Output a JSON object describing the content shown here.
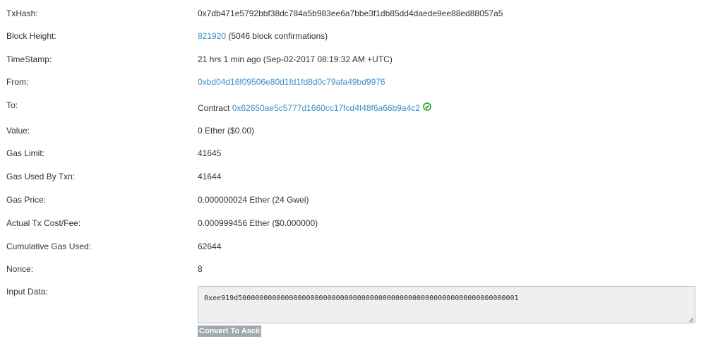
{
  "rows": {
    "txhash": {
      "label": "TxHash:",
      "value": "0x7db471e5792bbf38dc784a5b983ee6a7bbe3f1db85dd4daede9ee88ed88057a5"
    },
    "block_height": {
      "label": "Block Height:",
      "block": "821920",
      "confirmations": "(5046 block confirmations)"
    },
    "timestamp": {
      "label": "TimeStamp:",
      "value": "21 hrs 1 min ago (Sep-02-2017 08:19:32 AM +UTC)"
    },
    "from": {
      "label": "From:",
      "address": "0xbd04d16f09506e80d1fd1fd8d0c79afa49bd9976"
    },
    "to": {
      "label": "To:",
      "prefix": "Contract",
      "address": "0x62650ae5c5777d1660cc17fcd4f48f6a66b9a4c2",
      "icon": "check-circle-icon",
      "icon_color": "#1a9d1a"
    },
    "value": {
      "label": "Value:",
      "value": "0 Ether ($0.00)"
    },
    "gas_limit": {
      "label": "Gas Limit:",
      "value": "41645"
    },
    "gas_used": {
      "label": "Gas Used By Txn:",
      "value": "41644"
    },
    "gas_price": {
      "label": "Gas Price:",
      "value": "0.000000024 Ether (24 Gwei)"
    },
    "fee": {
      "label": "Actual Tx Cost/Fee:",
      "value": "0.000999456 Ether ($0.000000)"
    },
    "cumulative_gas": {
      "label": "Cumulative Gas Used:",
      "value": "62644"
    },
    "nonce": {
      "label": "Nonce:",
      "value": "8"
    },
    "input_data": {
      "label": "Input Data:",
      "value": "0xee919d500000000000000000000000000000000000000000000000000000000000000001"
    }
  },
  "convert_button": "Convert To Ascii",
  "colors": {
    "link": "#3d8fc4",
    "button_bg": "#9fa9ae",
    "textarea_bg": "#efefef"
  }
}
